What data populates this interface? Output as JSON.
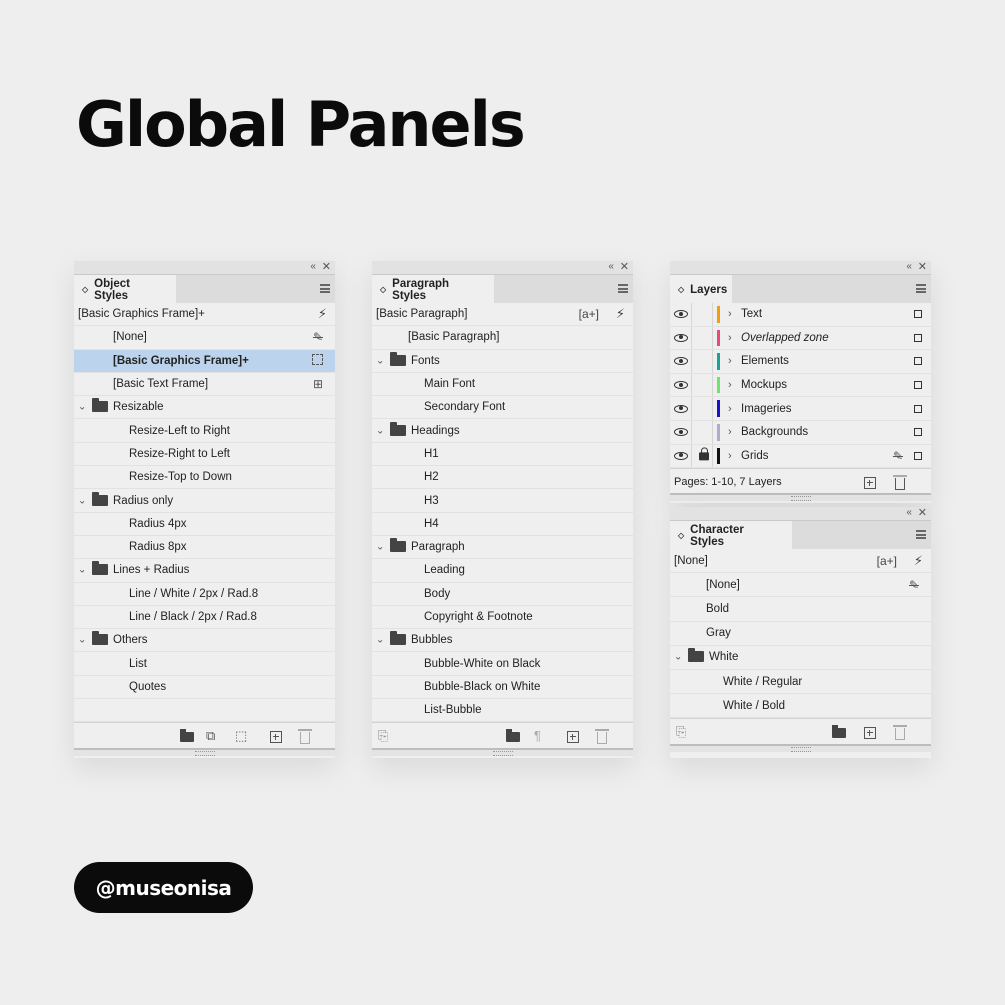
{
  "title": "Global Panels",
  "handle": "@museonisa",
  "icons": {
    "collapse": "«",
    "close": "✕",
    "updown": "⌃⌄",
    "chevron_down": "⌄",
    "chevron_right": "›",
    "bolt": "ϟ",
    "no_pen": "✎̸",
    "aplus": "[a+]"
  },
  "object_styles": {
    "tab": "Object Styles",
    "rows": [
      {
        "label": "[Basic Graphics Frame]+",
        "indent": 0,
        "icon": "bolt"
      },
      {
        "label": "[None]",
        "indent": 1,
        "icon": "no-pen"
      },
      {
        "label": "[Basic Graphics Frame]+",
        "indent": 1,
        "icon": "graphics-frame",
        "selected": true
      },
      {
        "label": "[Basic Text Frame]",
        "indent": 1,
        "icon": "text-frame"
      },
      {
        "label": "Resizable",
        "indent": 0,
        "folder": true
      },
      {
        "label": "Resize-Left to Right",
        "indent": 2
      },
      {
        "label": "Resize-Right to Left",
        "indent": 2
      },
      {
        "label": "Resize-Top to Down",
        "indent": 2
      },
      {
        "label": "Radius only",
        "indent": 0,
        "folder": true
      },
      {
        "label": "Radius 4px",
        "indent": 2
      },
      {
        "label": "Radius 8px",
        "indent": 2
      },
      {
        "label": "Lines + Radius",
        "indent": 0,
        "folder": true
      },
      {
        "label": "Line / White / 2px / Rad.8",
        "indent": 2
      },
      {
        "label": "Line / Black / 2px / Rad.8",
        "indent": 2
      },
      {
        "label": "Others",
        "indent": 0,
        "folder": true
      },
      {
        "label": "List",
        "indent": 2
      },
      {
        "label": "Quotes",
        "indent": 2
      },
      {
        "label": "",
        "indent": 0
      }
    ]
  },
  "paragraph_styles": {
    "tab": "Paragraph Styles",
    "rows": [
      {
        "label": "[Basic Paragraph]",
        "indent": 0,
        "icon": "aplus-bolt"
      },
      {
        "label": "[Basic Paragraph]",
        "indent": 1
      },
      {
        "label": "Fonts",
        "indent": 0,
        "folder": true
      },
      {
        "label": "Main Font",
        "indent": 2
      },
      {
        "label": "Secondary Font",
        "indent": 2
      },
      {
        "label": "Headings",
        "indent": 0,
        "folder": true
      },
      {
        "label": "H1",
        "indent": 2
      },
      {
        "label": "H2",
        "indent": 2
      },
      {
        "label": "H3",
        "indent": 2
      },
      {
        "label": "H4",
        "indent": 2
      },
      {
        "label": "Paragraph",
        "indent": 0,
        "folder": true
      },
      {
        "label": "Leading",
        "indent": 2
      },
      {
        "label": "Body",
        "indent": 2
      },
      {
        "label": "Copyright & Footnote",
        "indent": 2
      },
      {
        "label": "Bubbles",
        "indent": 0,
        "folder": true
      },
      {
        "label": "Bubble-White on Black",
        "indent": 2
      },
      {
        "label": "Bubble-Black on White",
        "indent": 2
      },
      {
        "label": "List-Bubble",
        "indent": 2
      }
    ]
  },
  "layers": {
    "tab": "Layers",
    "rows": [
      {
        "label": "Text",
        "color": "#f39c12",
        "italic": false,
        "locked": false
      },
      {
        "label": "Overlapped zone",
        "color": "#e84a7a",
        "italic": true,
        "locked": false
      },
      {
        "label": "Elements",
        "color": "#16a39a",
        "italic": false,
        "locked": false
      },
      {
        "label": "Mockups",
        "color": "#6fe36a",
        "italic": false,
        "locked": false
      },
      {
        "label": "Imageries",
        "color": "#1b12c9",
        "italic": false,
        "locked": false
      },
      {
        "label": "Backgrounds",
        "color": "#b3a9c9",
        "italic": false,
        "locked": false
      },
      {
        "label": "Grids",
        "color": "#111111",
        "italic": false,
        "locked": true
      }
    ],
    "status": "Pages: 1-10, 7 Layers"
  },
  "character_styles": {
    "tab": "Character Styles",
    "rows": [
      {
        "label": "[None]",
        "indent": 0,
        "icon": "aplus-bolt"
      },
      {
        "label": "[None]",
        "indent": 1,
        "icon": "no-pen"
      },
      {
        "label": "Bold",
        "indent": 1
      },
      {
        "label": "Gray",
        "indent": 1
      },
      {
        "label": "White",
        "indent": 0,
        "folder": true
      },
      {
        "label": "White / Regular",
        "indent": 2
      },
      {
        "label": "White / Bold",
        "indent": 2
      }
    ]
  }
}
